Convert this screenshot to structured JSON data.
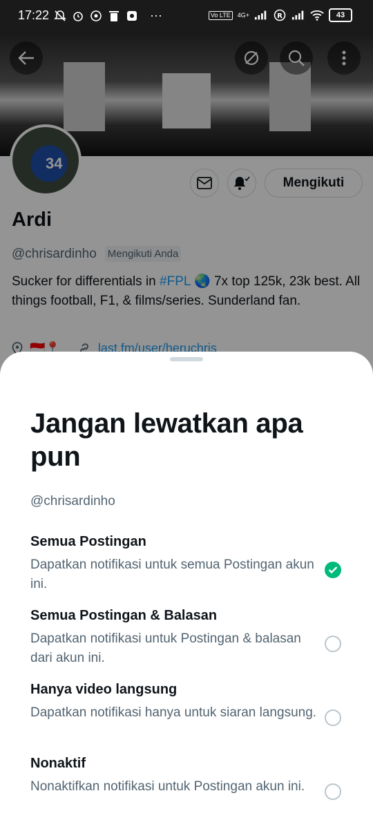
{
  "status_bar": {
    "time": "17:22",
    "left_icons": [
      "mute-bell-icon",
      "alarm-icon",
      "whatsapp-icon",
      "trash-icon",
      "app-icon"
    ],
    "overflow": "···",
    "volte": "Vo LTE",
    "network": "4G+",
    "battery": "43"
  },
  "profile": {
    "name": "Ardi",
    "handle": "@chrisardinho",
    "follows_you": "Mengikuti Anda",
    "follow_button": "Mengikuti",
    "avatar_number": "34",
    "bio_part1": "Sucker for differentials in ",
    "bio_hashtag": "#FPL",
    "bio_emoji": "🌏",
    "bio_part2": " 7x top 125k, 23k best. All things football, F1, & films/series. Sunderland fan.",
    "location": "🇮🇩📍",
    "link": "last.fm/user/heruchris"
  },
  "sheet": {
    "title": "Jangan lewatkan apa pun",
    "handle": "@chrisardinho",
    "options": [
      {
        "title": "Semua Postingan",
        "desc": "Dapatkan notifikasi untuk semua Postingan akun ini.",
        "selected": true
      },
      {
        "title": "Semua Postingan & Balasan",
        "desc": "Dapatkan notifikasi untuk Postingan & balasan dari akun ini.",
        "selected": false
      },
      {
        "title": "Hanya video langsung",
        "desc": "Dapatkan notifikasi hanya untuk siaran langsung.",
        "selected": false
      },
      {
        "title": "Nonaktif",
        "desc": "Nonaktifkan notifikasi untuk Postingan akun ini.",
        "selected": false
      }
    ]
  },
  "colors": {
    "accent": "#1d9bf0",
    "selected": "#00ba7c",
    "text_secondary": "#536471"
  }
}
